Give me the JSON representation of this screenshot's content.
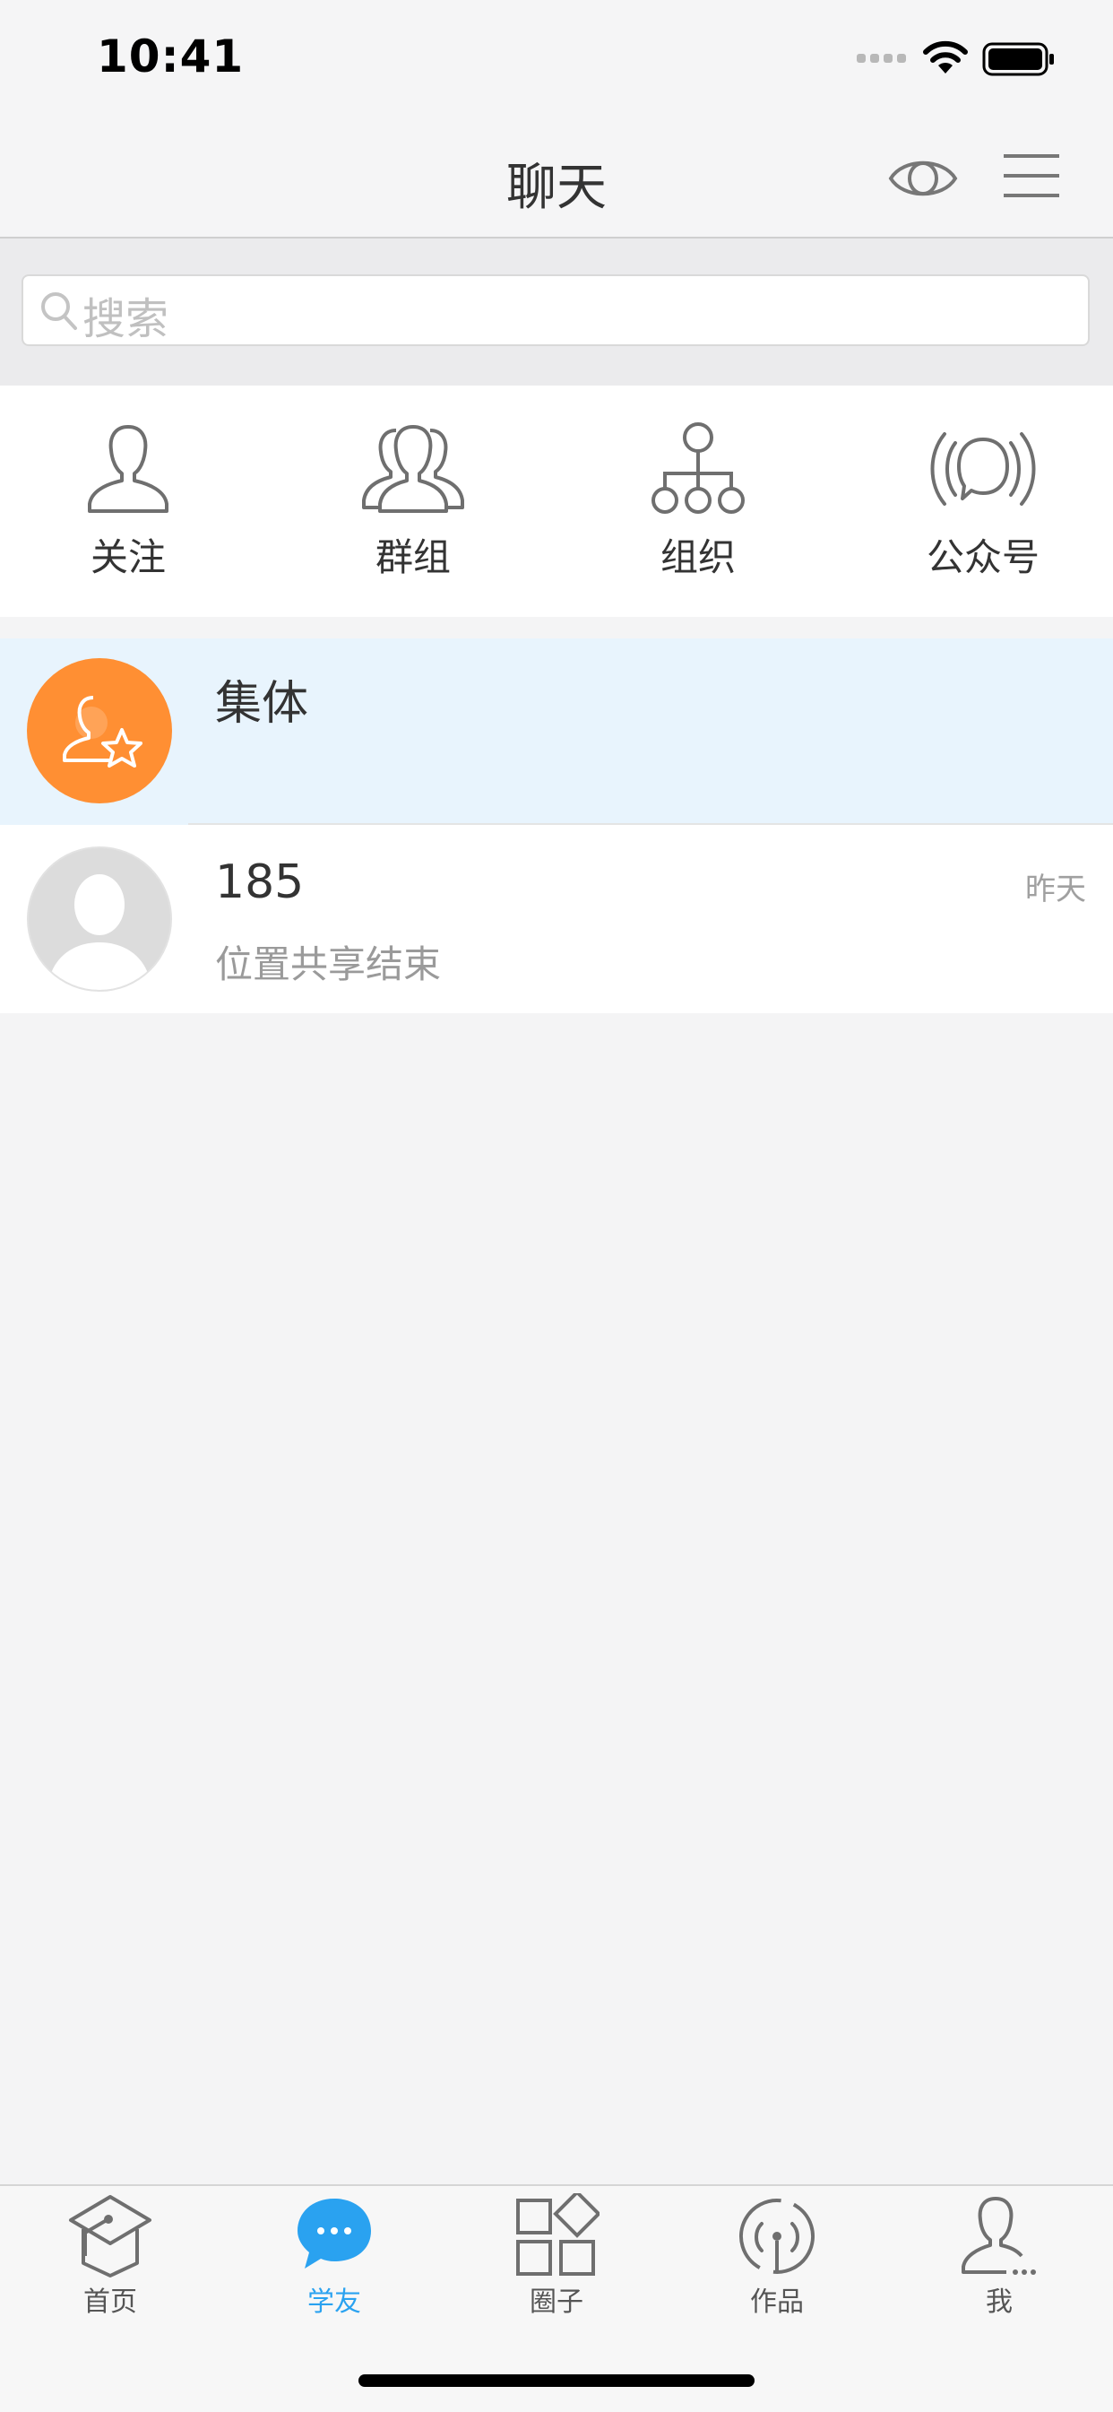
{
  "status_bar": {
    "time": "10:41",
    "icons": [
      "signal-dots-icon",
      "wifi-icon",
      "battery-icon"
    ]
  },
  "nav": {
    "title": "聊天",
    "right_icons": [
      "eye-icon",
      "menu-icon"
    ]
  },
  "search": {
    "placeholder": "搜索",
    "icon": "search-icon"
  },
  "shortcuts": [
    {
      "label": "关注",
      "icon": "person-icon"
    },
    {
      "label": "群组",
      "icon": "people-icon"
    },
    {
      "label": "组织",
      "icon": "org-chart-icon"
    },
    {
      "label": "公众号",
      "icon": "broadcast-chat-icon"
    }
  ],
  "chats": [
    {
      "name": "集体",
      "preview": "",
      "time": "",
      "avatar": "group-star-icon",
      "avatar_color": "#ff8f33",
      "highlighted": true
    },
    {
      "name": "185",
      "preview": "位置共享结束",
      "time": "昨天",
      "avatar": "default-user-icon",
      "avatar_color": "#dcdcdc",
      "highlighted": false
    }
  ],
  "tab_bar": {
    "active_index": 1,
    "active_color": "#2aa2f0",
    "items": [
      {
        "label": "首页",
        "icon": "graduation-cap-icon"
      },
      {
        "label": "学友",
        "icon": "chat-bubble-icon"
      },
      {
        "label": "圈子",
        "icon": "grid-squares-icon"
      },
      {
        "label": "作品",
        "icon": "broadcast-icon"
      },
      {
        "label": "我",
        "icon": "person-icon"
      }
    ]
  }
}
